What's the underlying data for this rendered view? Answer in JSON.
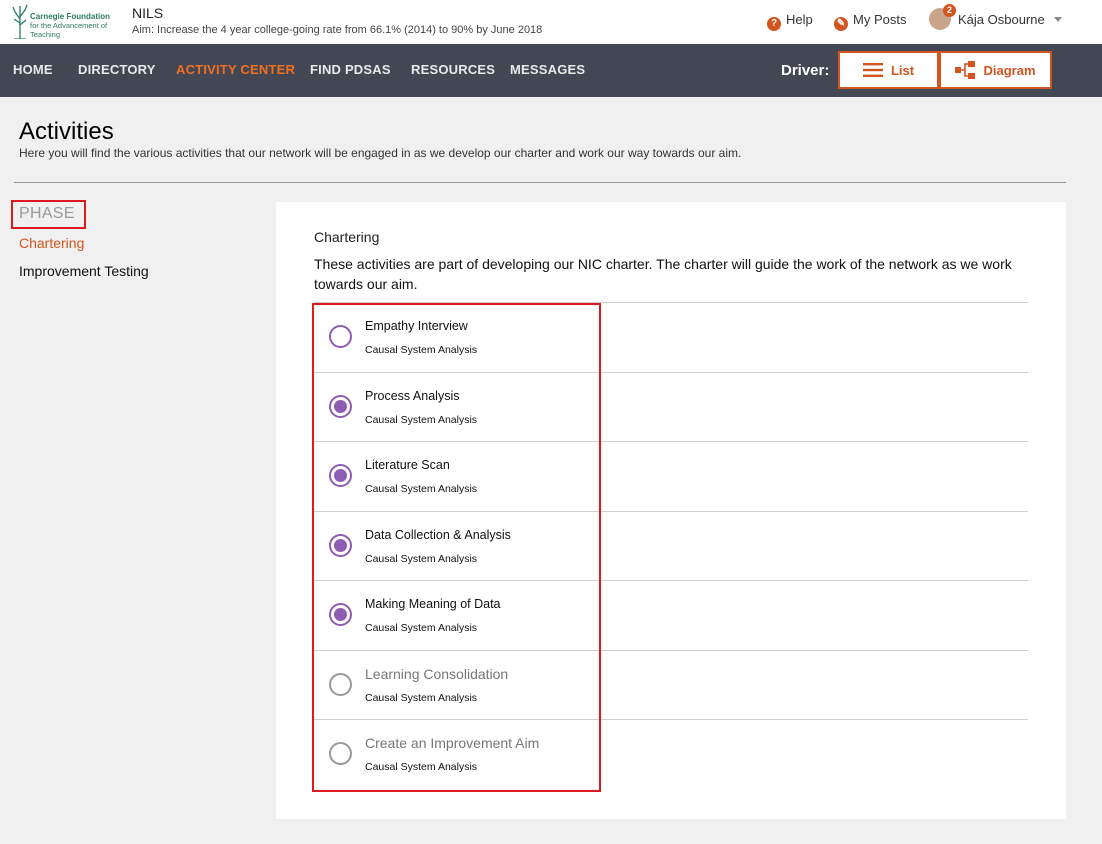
{
  "brand": {
    "logo_line1": "Carnegie Foundation",
    "logo_line2": "for the Advancement of Teaching",
    "network_name": "NILS",
    "aim": "Aim:  Increase the 4 year college-going rate from 66.1% (2014) to 90% by June 2018"
  },
  "header": {
    "help_label": "Help",
    "myposts_label": "My Posts",
    "user_name": "Kája Osbourne",
    "notification_count": "2"
  },
  "nav": {
    "items": [
      "HOME",
      "DIRECTORY",
      "ACTIVITY CENTER",
      "FIND PDSAS",
      "RESOURCES",
      "MESSAGES"
    ],
    "active": "ACTIVITY CENTER",
    "driver_label": "Driver:",
    "list_label": "List",
    "diagram_label": "Diagram"
  },
  "page": {
    "title": "Activities",
    "subtitle": "Here you will find the various activities that our network will be engaged in as we develop our charter and work our way towards our aim."
  },
  "phase": {
    "heading": "PHASE",
    "items": [
      "Chartering",
      "Improvement Testing"
    ],
    "active": "Chartering"
  },
  "card": {
    "title": "Chartering",
    "description": "These activities are part of developing our NIC charter. The charter will guide the work of the network as we work towards our aim.",
    "activities": [
      {
        "name": "Empathy Interview",
        "category": "Causal System Analysis",
        "status": "open"
      },
      {
        "name": "Process Analysis",
        "category": "Causal System Analysis",
        "status": "done"
      },
      {
        "name": "Literature Scan",
        "category": "Causal System Analysis",
        "status": "done"
      },
      {
        "name": "Data Collection & Analysis",
        "category": "Causal System Analysis",
        "status": "done"
      },
      {
        "name": "Making Meaning of Data",
        "category": "Causal System Analysis",
        "status": "done"
      },
      {
        "name": "Learning Consolidation",
        "category": "Causal System Analysis",
        "status": "locked"
      },
      {
        "name": "Create an Improvement Aim",
        "category": "Causal System Analysis",
        "status": "locked"
      }
    ]
  },
  "colors": {
    "accent": "#d2541f",
    "nav_active": "#f26f21",
    "nav_bg": "#434753",
    "radio": "#8e5bb5",
    "annotation": "#e0191f"
  }
}
